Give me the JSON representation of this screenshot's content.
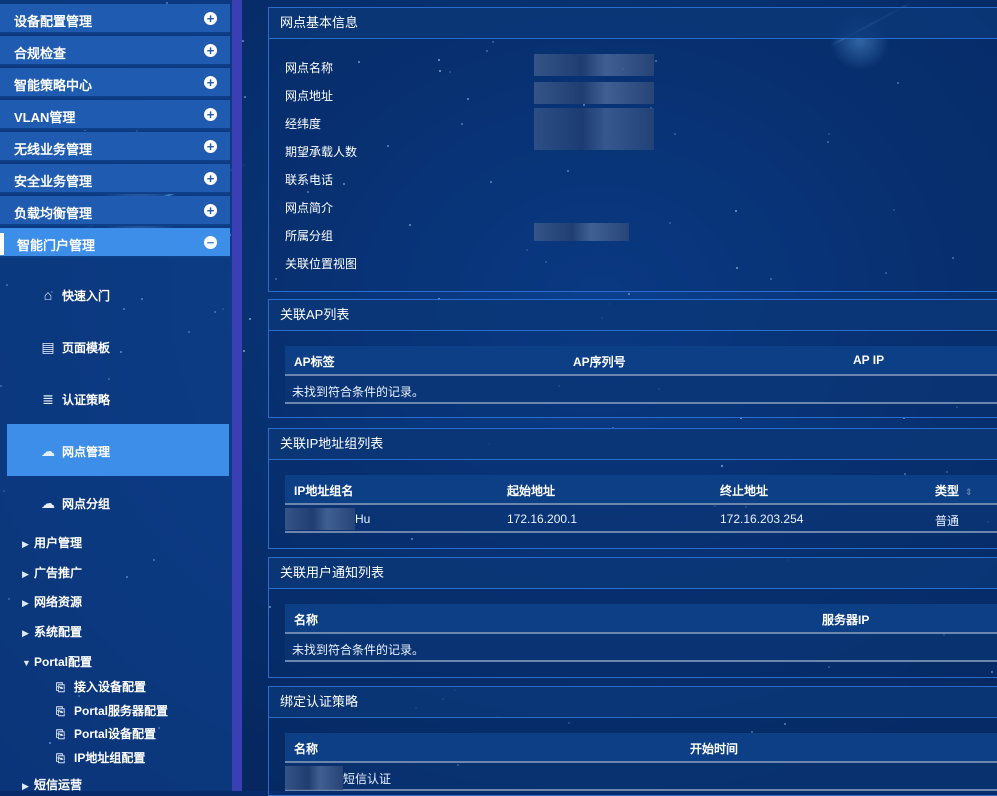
{
  "sidebar": {
    "menus": [
      {
        "label": "设备配置管理",
        "state": "+"
      },
      {
        "label": "合规检查",
        "state": "+"
      },
      {
        "label": "智能策略中心",
        "state": "+"
      },
      {
        "label": "VLAN管理",
        "state": "+"
      },
      {
        "label": "无线业务管理",
        "state": "+"
      },
      {
        "label": "安全业务管理",
        "state": "+"
      },
      {
        "label": "负载均衡管理",
        "state": "+"
      },
      {
        "label": "智能门户管理",
        "state": "−"
      }
    ],
    "sub_items": [
      {
        "label": "快速入门",
        "icon": "home-icon",
        "glyph": "⌂"
      },
      {
        "label": "页面模板",
        "icon": "template-icon",
        "glyph": "▤"
      },
      {
        "label": "认证策略",
        "icon": "auth-policy-icon",
        "glyph": "≣"
      },
      {
        "label": "网点管理",
        "icon": "cloud-icon",
        "glyph": "☁"
      },
      {
        "label": "网点分组",
        "icon": "cloud-group-icon",
        "glyph": "☁"
      }
    ],
    "tree": [
      {
        "label": "用户管理",
        "arrow": "▶"
      },
      {
        "label": "广告推广",
        "arrow": "▶"
      },
      {
        "label": "网络资源",
        "arrow": "▶"
      },
      {
        "label": "系统配置",
        "arrow": "▶"
      },
      {
        "label": "Portal配置",
        "arrow": "▼"
      }
    ],
    "portal_children": [
      {
        "label": "接入设备配置",
        "icon": "access-device-icon",
        "glyph": "⎘"
      },
      {
        "label": "Portal服务器配置",
        "icon": "portal-server-icon",
        "glyph": "⎘"
      },
      {
        "label": "Portal设备配置",
        "icon": "portal-device-icon",
        "glyph": "⎘"
      },
      {
        "label": "IP地址组配置",
        "icon": "ip-group-icon",
        "glyph": "⎘"
      }
    ],
    "tree_last": {
      "label": "短信运营",
      "arrow": "▶"
    }
  },
  "basic_info": {
    "title": "网点基本信息",
    "fields": [
      "网点名称",
      "网点地址",
      "经纬度",
      "期望承载人数",
      "联系电话",
      "网点简介",
      "所属分组",
      "关联位置视图"
    ]
  },
  "ap_list": {
    "title": "关联AP列表",
    "columns": [
      "AP标签",
      "AP序列号",
      "AP IP"
    ],
    "empty": "未找到符合条件的记录。"
  },
  "ip_group_list": {
    "title": "关联IP地址组列表",
    "columns": [
      "IP地址组名",
      "起始地址",
      "终止地址",
      "类型"
    ],
    "sort_glyph": "⇕",
    "rows": [
      {
        "name": "Hu",
        "start": "172.16.200.1",
        "end": "172.16.203.254",
        "type": "普通"
      }
    ]
  },
  "notify_list": {
    "title": "关联用户通知列表",
    "columns": [
      "名称",
      "服务器IP"
    ],
    "empty": "未找到符合条件的记录。"
  },
  "auth_policy": {
    "title": "绑定认证策略",
    "columns": [
      "名称",
      "开始时间"
    ],
    "rows": [
      {
        "name": "短信认证"
      }
    ]
  }
}
